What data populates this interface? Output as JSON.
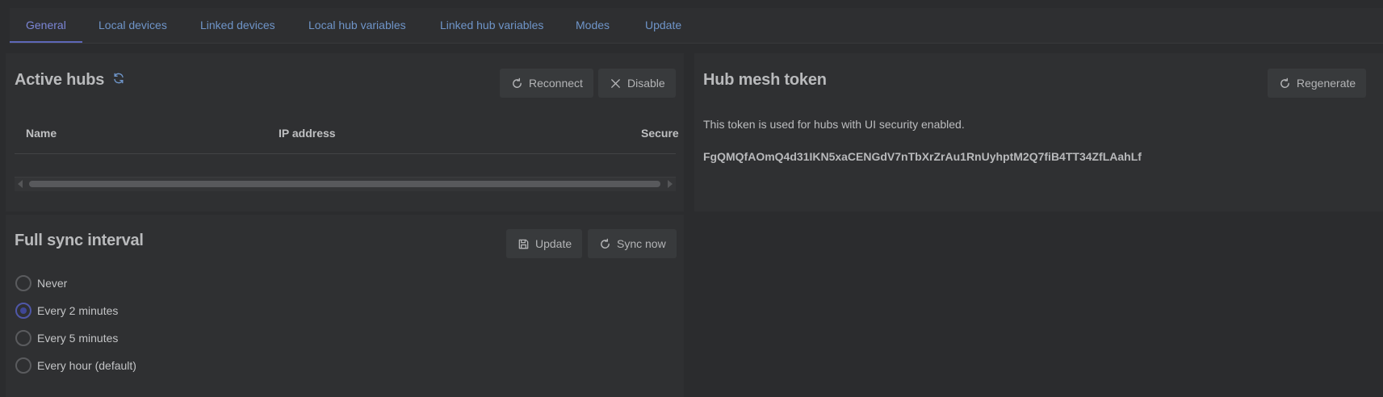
{
  "tabs": [
    {
      "label": "General",
      "active": true
    },
    {
      "label": "Local devices"
    },
    {
      "label": "Linked devices"
    },
    {
      "label": "Local hub variables"
    },
    {
      "label": "Linked hub variables"
    },
    {
      "label": "Modes"
    },
    {
      "label": "Update"
    }
  ],
  "active_hubs": {
    "title": "Active hubs",
    "refresh_icon": "refresh-icon",
    "reconnect_label": "Reconnect",
    "disable_label": "Disable",
    "columns": [
      "Name",
      "IP address",
      "Secure"
    ]
  },
  "hub_mesh": {
    "title": "Hub mesh token",
    "regenerate_label": "Regenerate",
    "description": "This token is used for hubs with UI security enabled.",
    "token": "FgQMQfAOmQ4d31IKN5xaCENGdV7nTbXrZrAu1RnUyhptM2Q7fiB4TT34ZfLAahLf"
  },
  "sync": {
    "title": "Full sync interval",
    "update_label": "Update",
    "sync_now_label": "Sync now",
    "options": [
      {
        "label": "Never",
        "checked": false
      },
      {
        "label": "Every 2 minutes",
        "checked": true
      },
      {
        "label": "Every 5 minutes",
        "checked": false
      },
      {
        "label": "Every hour (default)",
        "checked": false
      }
    ]
  },
  "colors": {
    "accent": "#5d67b8",
    "tab_text": "#6f95c9",
    "background": "#2b2c2e"
  }
}
